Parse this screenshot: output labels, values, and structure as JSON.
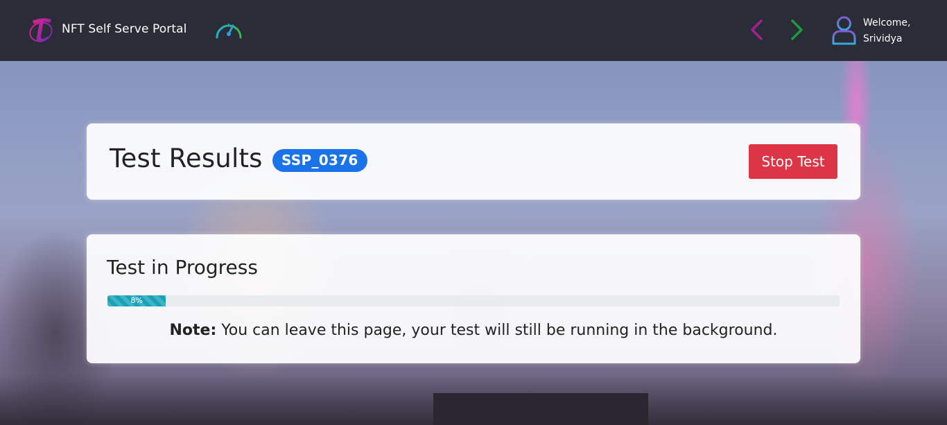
{
  "header": {
    "brand_name": "NFT Self Serve Portal",
    "welcome_line1": "Welcome,",
    "welcome_line2": "Srividya",
    "icons": {
      "logo": "telstra-t-logo",
      "dashboard": "speedometer-gauge-icon",
      "back": "chevron-left-icon",
      "forward": "chevron-right-icon",
      "user": "user-profile-icon"
    }
  },
  "results": {
    "title": "Test Results",
    "badge": "SSP_0376",
    "stop_label": "Stop Test"
  },
  "progress": {
    "title": "Test in Progress",
    "percent": 8,
    "percent_label": "8%",
    "note_label": "Note:",
    "note_text": " You can leave this page, your test will still be running in the background."
  },
  "colors": {
    "topbar": "#2a2d38",
    "badge": "#1a73e8",
    "stop_button": "#dc3545",
    "progress_fill": "#17a2b8",
    "back_arrow": "#a3208f",
    "forward_arrow": "#1f9a3a"
  }
}
